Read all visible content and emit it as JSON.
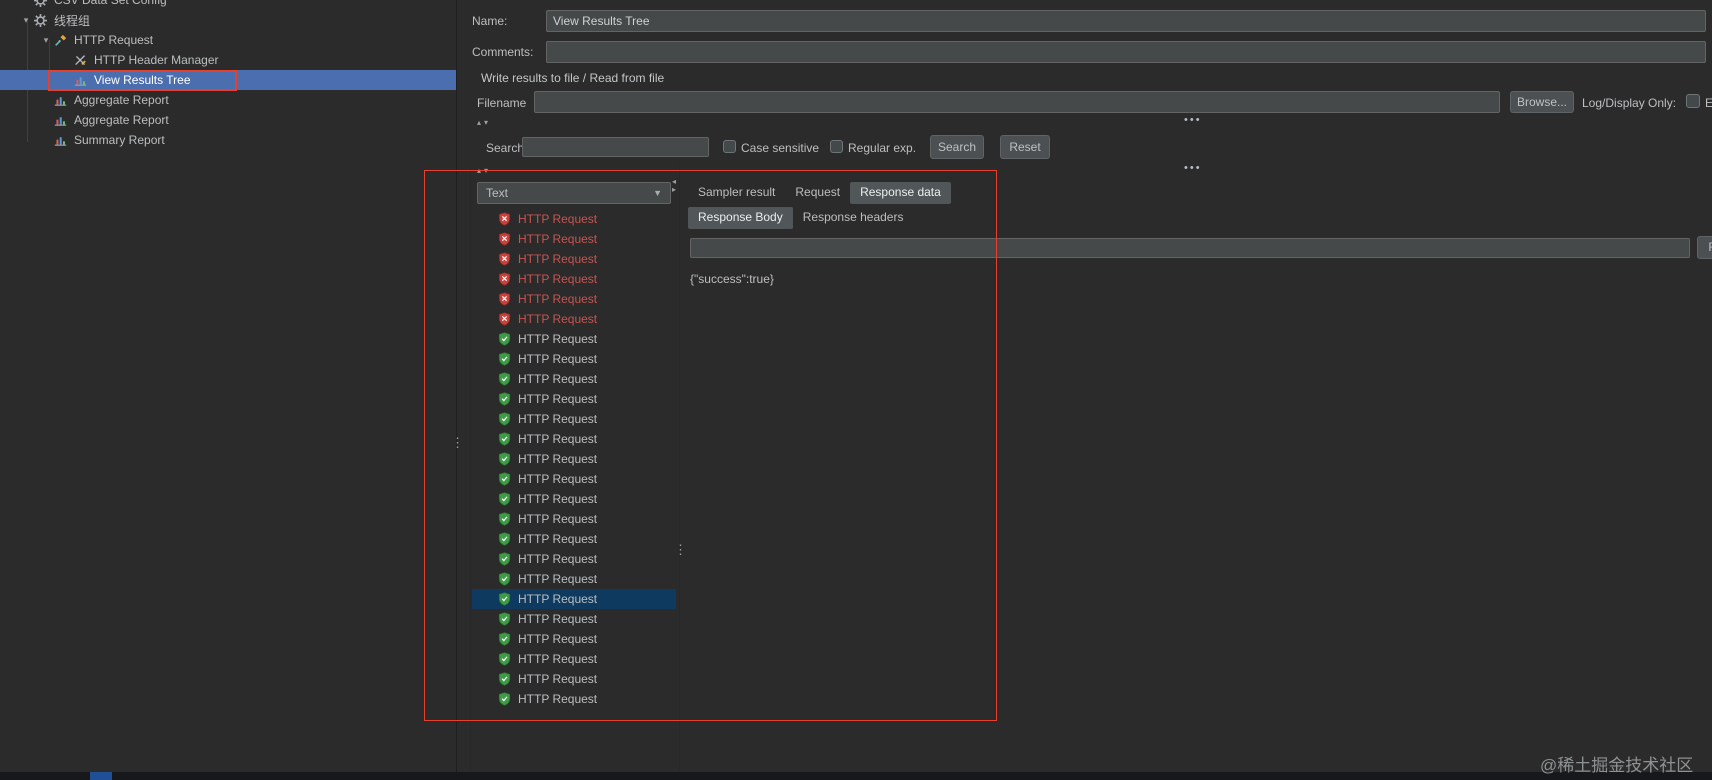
{
  "colors": {
    "tree_selection_blue": "#4b6eaf",
    "list_selection_navy": "#0d3a5e",
    "error_red": "#c75450",
    "ok_green": "#3e9c46",
    "annotation_red": "#e8402e"
  },
  "tree": {
    "items": [
      {
        "label": "CSV Data Set Config",
        "icon": "gear-icon",
        "level": 0,
        "chevron": false
      },
      {
        "label": "线程组",
        "icon": "gear-icon",
        "level": 0,
        "chevron": true
      },
      {
        "label": "HTTP Request",
        "icon": "sampler-icon",
        "level": 1,
        "chevron": true
      },
      {
        "label": "HTTP Header Manager",
        "icon": "header-manager-icon",
        "level": 2,
        "chevron": false
      },
      {
        "label": "View Results Tree",
        "icon": "chart-icon",
        "level": 2,
        "chevron": false,
        "selected": true
      },
      {
        "label": "Aggregate Report",
        "icon": "chart-icon",
        "level": 1,
        "chevron": false
      },
      {
        "label": "Aggregate Report",
        "icon": "chart-icon",
        "level": 1,
        "chevron": false
      },
      {
        "label": "Summary Report",
        "icon": "chart-icon",
        "level": 1,
        "chevron": false
      }
    ]
  },
  "form": {
    "name_label": "Name:",
    "name_value": "View Results Tree",
    "comments_label": "Comments:",
    "comments_value": "",
    "file_section_label": "Write results to file / Read from file",
    "filename_label": "Filename",
    "filename_value": "",
    "browse_button": "Browse...",
    "log_display_label": "Log/Display Only:",
    "errors_label": "E"
  },
  "search_bar": {
    "label": "Search:",
    "value": "",
    "case_sensitive_label": "Case sensitive",
    "regexp_label": "Regular exp.",
    "search_button": "Search",
    "reset_button": "Reset"
  },
  "results": {
    "filter_value": "Text",
    "selected_index": 19,
    "items": [
      {
        "label": "HTTP Request",
        "status": "error"
      },
      {
        "label": "HTTP Request",
        "status": "error"
      },
      {
        "label": "HTTP Request",
        "status": "error"
      },
      {
        "label": "HTTP Request",
        "status": "error"
      },
      {
        "label": "HTTP Request",
        "status": "error"
      },
      {
        "label": "HTTP Request",
        "status": "error"
      },
      {
        "label": "HTTP Request",
        "status": "ok"
      },
      {
        "label": "HTTP Request",
        "status": "ok"
      },
      {
        "label": "HTTP Request",
        "status": "ok"
      },
      {
        "label": "HTTP Request",
        "status": "ok"
      },
      {
        "label": "HTTP Request",
        "status": "ok"
      },
      {
        "label": "HTTP Request",
        "status": "ok"
      },
      {
        "label": "HTTP Request",
        "status": "ok"
      },
      {
        "label": "HTTP Request",
        "status": "ok"
      },
      {
        "label": "HTTP Request",
        "status": "ok"
      },
      {
        "label": "HTTP Request",
        "status": "ok"
      },
      {
        "label": "HTTP Request",
        "status": "ok"
      },
      {
        "label": "HTTP Request",
        "status": "ok"
      },
      {
        "label": "HTTP Request",
        "status": "ok"
      },
      {
        "label": "HTTP Request",
        "status": "ok"
      },
      {
        "label": "HTTP Request",
        "status": "ok"
      },
      {
        "label": "HTTP Request",
        "status": "ok"
      },
      {
        "label": "HTTP Request",
        "status": "ok"
      },
      {
        "label": "HTTP Request",
        "status": "ok"
      },
      {
        "label": "HTTP Request",
        "status": "ok"
      }
    ]
  },
  "response": {
    "tabs": [
      "Sampler result",
      "Request",
      "Response data"
    ],
    "active_tab": "Response data",
    "subtabs": [
      "Response Body",
      "Response headers"
    ],
    "active_subtab": "Response Body",
    "search_value": "",
    "find_button": "F",
    "body": "{\"success\":true}"
  },
  "watermark": "@稀土掘金技术社区"
}
